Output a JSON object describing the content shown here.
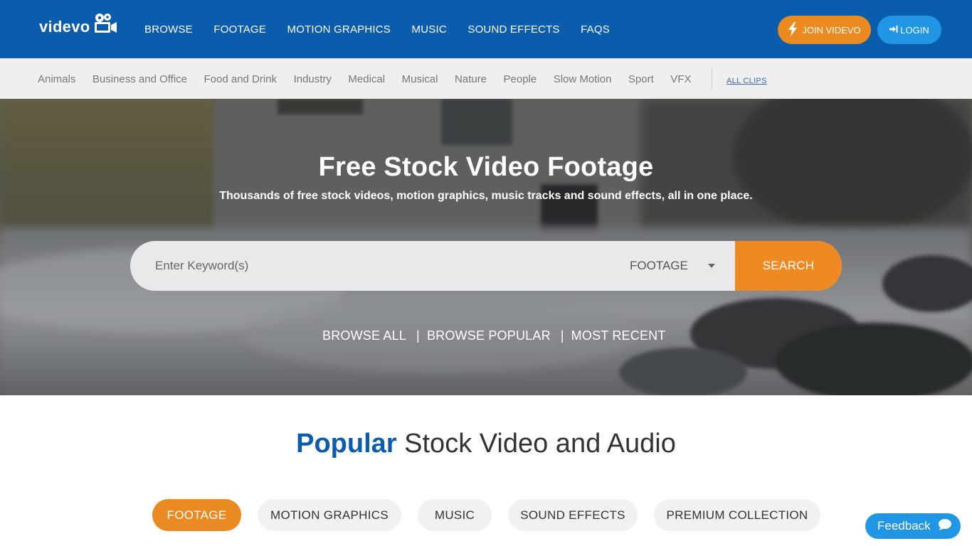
{
  "header": {
    "logo_text": "videvo",
    "nav": [
      "BROWSE",
      "FOOTAGE",
      "MOTION GRAPHICS",
      "MUSIC",
      "SOUND EFFECTS",
      "FAQS"
    ],
    "join_label": "JOIN VIDEVO",
    "login_label": "LOGIN"
  },
  "categories": {
    "items": [
      "Animals",
      "Business and Office",
      "Food and Drink",
      "Industry",
      "Medical",
      "Musical",
      "Nature",
      "People",
      "Slow Motion",
      "Sport",
      "VFX"
    ],
    "all_clips": "ALL CLIPS"
  },
  "hero": {
    "title": "Free Stock Video Footage",
    "subtitle": "Thousands of free stock videos, motion graphics, music tracks and sound effects, all in one place.",
    "search_placeholder": "Enter Keyword(s)",
    "search_type": "FOOTAGE",
    "search_button": "SEARCH",
    "browse_links": [
      "BROWSE ALL",
      "BROWSE POPULAR",
      "MOST RECENT"
    ],
    "separator": "|"
  },
  "popular": {
    "title_accent": "Popular",
    "title_rest": " Stock Video and Audio",
    "tabs": [
      "FOOTAGE",
      "MOTION GRAPHICS",
      "MUSIC",
      "SOUND EFFECTS",
      "PREMIUM COLLECTION"
    ],
    "active_tab": "FOOTAGE"
  },
  "feedback_label": "Feedback",
  "colors": {
    "brand_blue": "#0a5cad",
    "accent_orange": "#ef8a22",
    "login_blue": "#2196e4"
  }
}
